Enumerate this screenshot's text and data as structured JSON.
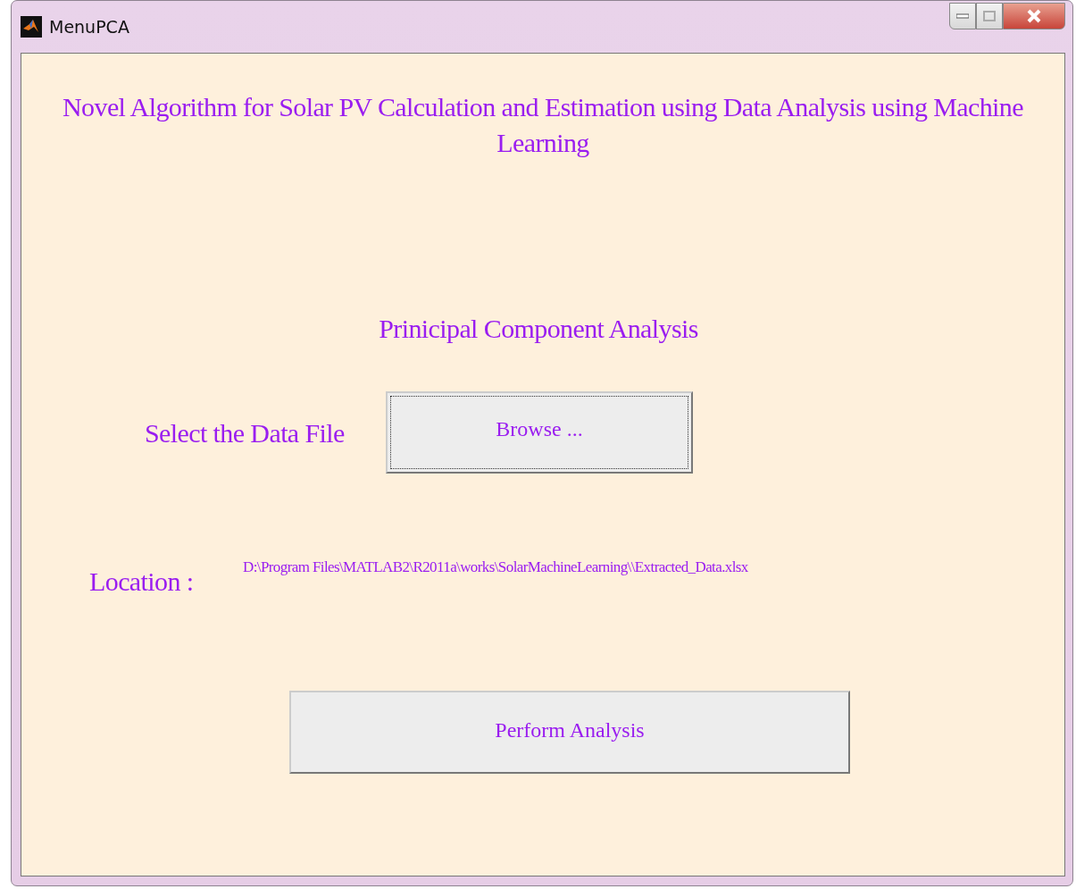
{
  "window": {
    "title": "MenuPCA"
  },
  "heading": "Novel Algorithm for Solar PV Calculation and Estimation using Data Analysis using Machine Learning",
  "subheading": "Prinicipal Component Analysis",
  "file_select": {
    "label": "Select the Data File",
    "button": "Browse ...",
    "focused": true
  },
  "location": {
    "label": "Location :",
    "path": "D:\\Program Files\\MATLAB2\\R2011a\\works\\SolarMachineLearning\\\\Extracted_Data.xlsx"
  },
  "action_button": "Perform Analysis"
}
